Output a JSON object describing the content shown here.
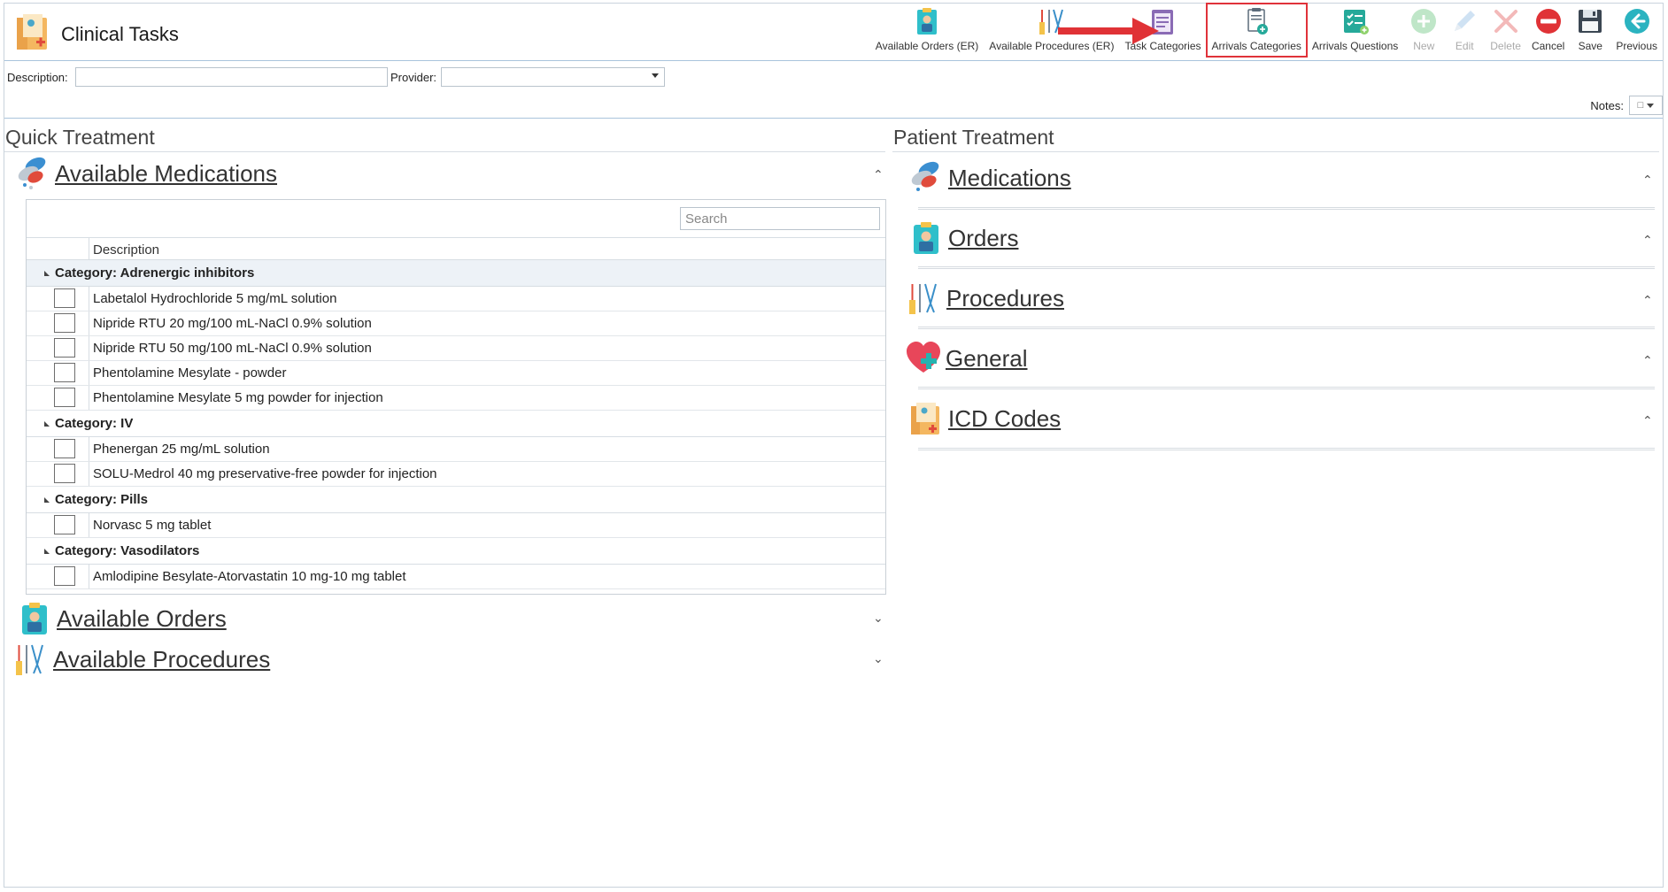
{
  "app": {
    "title": "Clinical Tasks"
  },
  "toolbar": [
    {
      "id": "available-orders-er",
      "label": "Available Orders (ER)",
      "icon": "clipboard-doctor-icon",
      "enabled": true
    },
    {
      "id": "available-procedures-er",
      "label": "Available Procedures (ER)",
      "icon": "surgical-tools-icon",
      "enabled": true
    },
    {
      "id": "task-categories",
      "label": "Task Categories",
      "icon": "list-clipboard-icon",
      "enabled": true
    },
    {
      "id": "arrivals-categories",
      "label": "Arrivals Categories",
      "icon": "document-add-icon",
      "enabled": true,
      "highlighted": true
    },
    {
      "id": "arrivals-questions",
      "label": "Arrivals Questions",
      "icon": "checklist-icon",
      "enabled": true
    },
    {
      "id": "new",
      "label": "New",
      "icon": "plus-circle-icon",
      "enabled": false
    },
    {
      "id": "edit",
      "label": "Edit",
      "icon": "pencil-icon",
      "enabled": false
    },
    {
      "id": "delete",
      "label": "Delete",
      "icon": "x-icon",
      "enabled": false
    },
    {
      "id": "cancel",
      "label": "Cancel",
      "icon": "no-entry-icon",
      "enabled": true
    },
    {
      "id": "save",
      "label": "Save",
      "icon": "floppy-disk-icon",
      "enabled": true
    },
    {
      "id": "previous",
      "label": "Previous",
      "icon": "arrow-left-circle-icon",
      "enabled": true
    }
  ],
  "filters": {
    "description_label": "Description:",
    "description_value": "",
    "provider_label": "Provider:",
    "provider_value": "",
    "notes_label": "Notes:"
  },
  "quick_treatment": {
    "title": "Quick Treatment",
    "available_medications": {
      "label": "Available Medications",
      "search_placeholder": "Search",
      "column_description": "Description",
      "categories": [
        {
          "name": "Category: Adrenergic inhibitors",
          "items": [
            "Labetalol Hydrochloride 5 mg/mL solution",
            "Nipride RTU 20 mg/100 mL-NaCl 0.9% solution",
            "Nipride RTU 50 mg/100 mL-NaCl 0.9% solution",
            "Phentolamine Mesylate - powder",
            "Phentolamine Mesylate 5 mg powder for injection"
          ]
        },
        {
          "name": "Category: IV",
          "items": [
            "Phenergan 25 mg/mL solution",
            "SOLU-Medrol 40 mg preservative-free powder for injection"
          ]
        },
        {
          "name": "Category: Pills",
          "items": [
            "Norvasc 5 mg tablet"
          ]
        },
        {
          "name": "Category: Vasodilators",
          "items": [
            "Amlodipine Besylate-Atorvastatin 10 mg-10 mg tablet"
          ]
        }
      ]
    },
    "available_orders": {
      "label": "Available Orders"
    },
    "available_procedures": {
      "label": "Available Procedures"
    }
  },
  "patient_treatment": {
    "title": "Patient Treatment",
    "sections": [
      {
        "label": "Medications",
        "icon": "pills-icon"
      },
      {
        "label": "Orders",
        "icon": "clipboard-doctor-icon"
      },
      {
        "label": "Procedures",
        "icon": "surgical-tools-icon"
      },
      {
        "label": "General",
        "icon": "heart-plus-icon"
      },
      {
        "label": "ICD Codes",
        "icon": "medical-folder-icon"
      }
    ]
  },
  "colors": {
    "accent_blue": "#a9c4dc",
    "highlight_red": "#e0323a",
    "arrow_red": "#e03236",
    "teal": "#26a99a",
    "disabled_gray": "#aaaaaa"
  }
}
